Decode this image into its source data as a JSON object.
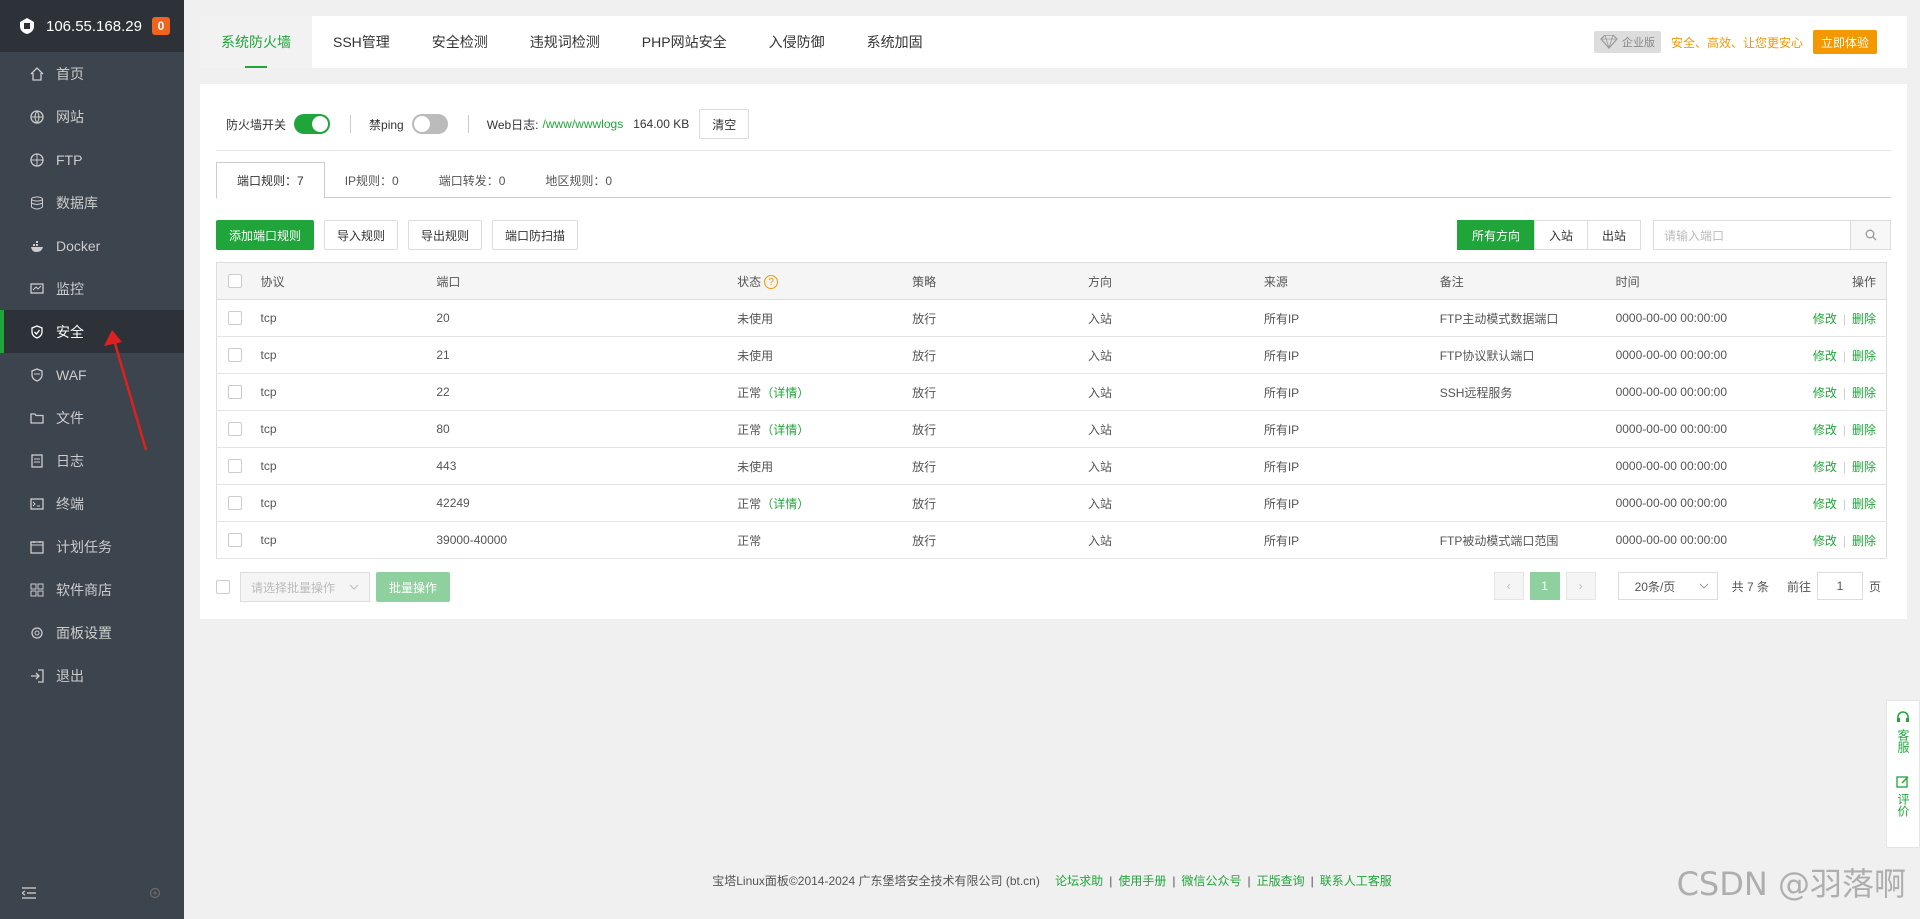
{
  "sidebar": {
    "ip": "106.55.168.29",
    "badge": "0",
    "items": [
      {
        "label": "首页",
        "icon": "home-icon"
      },
      {
        "label": "网站",
        "icon": "globe-icon"
      },
      {
        "label": "FTP",
        "icon": "ftp-icon"
      },
      {
        "label": "数据库",
        "icon": "database-icon"
      },
      {
        "label": "Docker",
        "icon": "docker-icon"
      },
      {
        "label": "监控",
        "icon": "monitor-icon"
      },
      {
        "label": "安全",
        "icon": "shield-icon"
      },
      {
        "label": "WAF",
        "icon": "waf-icon"
      },
      {
        "label": "文件",
        "icon": "folder-icon"
      },
      {
        "label": "日志",
        "icon": "log-icon"
      },
      {
        "label": "终端",
        "icon": "terminal-icon"
      },
      {
        "label": "计划任务",
        "icon": "calendar-icon"
      },
      {
        "label": "软件商店",
        "icon": "apps-icon"
      },
      {
        "label": "面板设置",
        "icon": "settings-icon"
      },
      {
        "label": "退出",
        "icon": "logout-icon"
      }
    ],
    "active_index": 6
  },
  "tabs": [
    "系统防火墙",
    "SSH管理",
    "安全检测",
    "违规词检测",
    "PHP网站安全",
    "入侵防御",
    "系统加固"
  ],
  "promo": {
    "edition": "企业版",
    "slogan": "安全、高效、让您更安心",
    "trial": "立即体验"
  },
  "switches": {
    "firewall_label": "防火墙开关",
    "ping_label": "禁ping",
    "weblog_label": "Web日志:",
    "weblog_path": "/www/wwwlogs",
    "weblog_size": "164.00 KB",
    "clear": "清空"
  },
  "subtabs": [
    "端口规则：7",
    "IP规则：0",
    "端口转发：0",
    "地区规则：0"
  ],
  "toolbar": {
    "add": "添加端口规则",
    "import": "导入规则",
    "export": "导出规则",
    "scan": "端口防扫描",
    "dir_all": "所有方向",
    "dir_in": "入站",
    "dir_out": "出站",
    "search_placeholder": "请输入端口"
  },
  "table": {
    "headers": [
      "协议",
      "端口",
      "状态",
      "策略",
      "方向",
      "来源",
      "备注",
      "时间",
      "操作"
    ],
    "rows": [
      {
        "proto": "tcp",
        "port": "20",
        "status": "未使用",
        "detail": "",
        "policy": "放行",
        "dir": "入站",
        "src": "所有IP",
        "note": "FTP主动模式数据端口",
        "time": "0000-00-00 00:00:00"
      },
      {
        "proto": "tcp",
        "port": "21",
        "status": "未使用",
        "detail": "",
        "policy": "放行",
        "dir": "入站",
        "src": "所有IP",
        "note": "FTP协议默认端口",
        "time": "0000-00-00 00:00:00"
      },
      {
        "proto": "tcp",
        "port": "22",
        "status": "正常",
        "detail": "（详情）",
        "policy": "放行",
        "dir": "入站",
        "src": "所有IP",
        "note": "SSH远程服务",
        "time": "0000-00-00 00:00:00"
      },
      {
        "proto": "tcp",
        "port": "80",
        "status": "正常",
        "detail": "（详情）",
        "policy": "放行",
        "dir": "入站",
        "src": "所有IP",
        "note": "",
        "time": "0000-00-00 00:00:00"
      },
      {
        "proto": "tcp",
        "port": "443",
        "status": "未使用",
        "detail": "",
        "policy": "放行",
        "dir": "入站",
        "src": "所有IP",
        "note": "",
        "time": "0000-00-00 00:00:00"
      },
      {
        "proto": "tcp",
        "port": "42249",
        "status": "正常",
        "detail": "（详情）",
        "policy": "放行",
        "dir": "入站",
        "src": "所有IP",
        "note": "",
        "time": "0000-00-00 00:00:00"
      },
      {
        "proto": "tcp",
        "port": "39000-40000",
        "status": "正常",
        "detail": "",
        "policy": "放行",
        "dir": "入站",
        "src": "所有IP",
        "note": "FTP被动模式端口范围",
        "time": "0000-00-00 00:00:00"
      }
    ],
    "op_edit": "修改",
    "op_delete": "删除"
  },
  "batch": {
    "placeholder": "请选择批量操作",
    "button": "批量操作"
  },
  "pager": {
    "current": "1",
    "page_size": "20条/页",
    "total": "共 7 条",
    "goto": "前往",
    "goto_value": "1",
    "page_unit": "页"
  },
  "float": {
    "service": "客服",
    "review": "评价"
  },
  "footer": {
    "copyright": "宝塔Linux面板©2014-2024 广东堡塔安全技术有限公司 (bt.cn)",
    "links": [
      "论坛求助",
      "使用手册",
      "微信公众号",
      "正版查询",
      "联系人工客服"
    ]
  },
  "watermark": "CSDN @羽落啊",
  "colors": {
    "accent": "#20a53a",
    "sidebar": "#3c444d",
    "promo": "#f39800",
    "arrow": "#e02020"
  }
}
